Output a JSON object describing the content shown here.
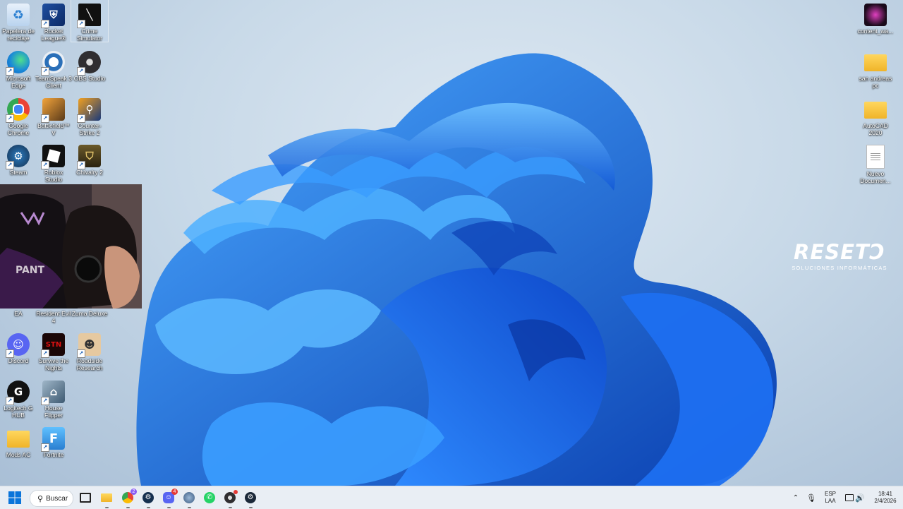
{
  "desktop": {
    "icons_left": [
      {
        "label": "Papelera de reciclaje",
        "icon": "recycle-bin-icon"
      },
      {
        "label": "Rocket League®",
        "icon": "rocket-league-icon"
      },
      {
        "label": "Crime Simulator",
        "icon": "crime-simulator-icon"
      },
      {
        "label": "Microsoft Edge",
        "icon": "edge-icon"
      },
      {
        "label": "TeamSpeak 3 Client",
        "icon": "teamspeak-icon"
      },
      {
        "label": "OBS Studio",
        "icon": "obs-icon"
      },
      {
        "label": "Google Chrome",
        "icon": "chrome-icon"
      },
      {
        "label": "Battlefield™ V",
        "icon": "battlefield-icon"
      },
      {
        "label": "Counter-Strike 2",
        "icon": "counter-strike-icon"
      },
      {
        "label": "Steam",
        "icon": "steam-icon"
      },
      {
        "label": "Roblox Studio",
        "icon": "roblox-icon"
      },
      {
        "label": "Chivalry 2",
        "icon": "chivalry-icon"
      },
      {
        "label": "EA",
        "icon": "ea-icon"
      },
      {
        "label": "Resident Evil 4",
        "icon": "resident-evil-icon"
      },
      {
        "label": "Zuma Deluxe",
        "icon": "zuma-icon"
      },
      {
        "label": "Discord",
        "icon": "discord-icon"
      },
      {
        "label": "Survive the Nights",
        "icon": "survive-the-nights-icon"
      },
      {
        "label": "Roadside Research",
        "icon": "roadside-research-icon"
      },
      {
        "label": "Logitech G HUB",
        "icon": "logitech-icon"
      },
      {
        "label": "House Flipper",
        "icon": "house-flipper-icon"
      },
      {
        "label": "Mods AC",
        "icon": "folder-icon"
      },
      {
        "label": "Fortnite",
        "icon": "fortnite-icon"
      }
    ],
    "icons_right": [
      {
        "label": "content_wa...",
        "icon": "image-file-icon"
      },
      {
        "label": "san andreas pc",
        "icon": "folder-icon"
      },
      {
        "label": "AutoCAD 2020",
        "icon": "folder-icon"
      },
      {
        "label": "Nuevo Documen...",
        "icon": "text-document-icon"
      }
    ],
    "watermark": {
      "title": "RESETↃ",
      "subtitle": "SOLUCIONES INFORMÁTICAS"
    },
    "webcam_overlay": {
      "chair_text": "PANT"
    }
  },
  "taskbar": {
    "search_label": "Buscar",
    "apps": [
      "file-explorer-icon",
      "chrome-icon",
      "steam-icon",
      "discord-icon",
      "browser-icon",
      "whatsapp-icon",
      "obs-icon",
      "steam-icon"
    ],
    "chrome_badge": "2",
    "discord_badge": "4",
    "language": {
      "line1": "ESP",
      "line2": "LAA"
    },
    "time": "18:41",
    "date": "2/4/2026"
  },
  "colors": {
    "wallpaper_blue": "#1565d8",
    "taskbar_bg": "#e9eef4"
  }
}
